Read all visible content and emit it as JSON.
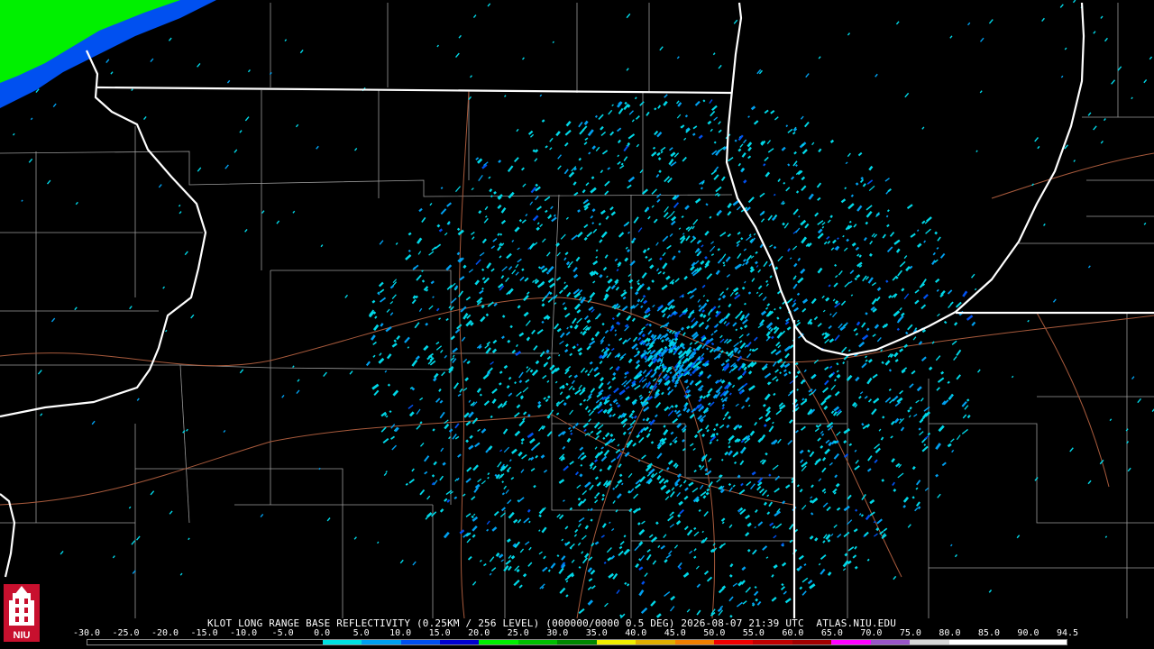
{
  "caption": "KLOT LONG RANGE BASE REFLECTIVITY (0.25KM / 256 LEVEL) (000000/0000 0.5 DEG) 2026-08-07 21:39 UTC  ATLAS.NIU.EDU",
  "logo": {
    "text": "NIU",
    "icon": "niu-tower-logo-icon"
  },
  "scale": {
    "labels": [
      "-30.0",
      "-25.0",
      "-20.0",
      "-15.0",
      "-10.0",
      "-5.0",
      "0.0",
      "5.0",
      "10.0",
      "15.0",
      "20.0",
      "25.0",
      "30.0",
      "35.0",
      "40.0",
      "45.0",
      "50.0",
      "55.0",
      "60.0",
      "65.0",
      "70.0",
      "75.0",
      "80.0",
      "85.0",
      "90.0",
      "94.5"
    ],
    "colors": [
      "#000000",
      "#000000",
      "#000000",
      "#000000",
      "#000000",
      "#000000",
      "#00e0e0",
      "#00a0f0",
      "#0050f0",
      "#0000d0",
      "#00f000",
      "#00c000",
      "#008800",
      "#f0f000",
      "#e0b000",
      "#f08000",
      "#f00000",
      "#c00000",
      "#a00000",
      "#ff00ff",
      "#9955c8",
      "#d8d8d8",
      "#ffffff",
      "#ffffff",
      "#ffffff"
    ]
  },
  "colors": {
    "state_border": "#ffffff",
    "county_border": "#9a9a9a",
    "highway": "#a85a3c",
    "echo_light": "#00d8e8",
    "echo_mid": "#00a0f0",
    "echo_dark": "#0050f0",
    "echo_green": "#00f000"
  }
}
